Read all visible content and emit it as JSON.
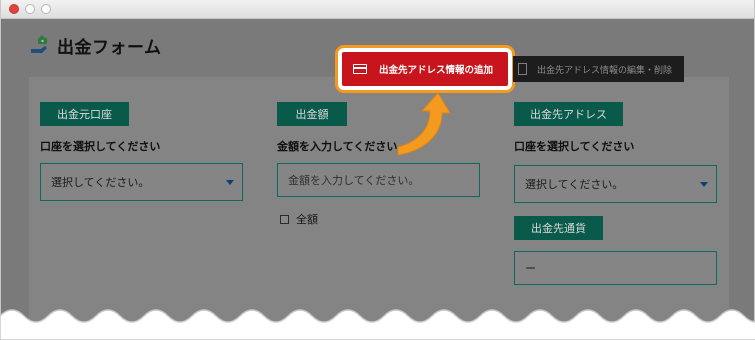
{
  "app": {
    "title": "出金フォーム",
    "title_icon": "money-transfer-icon"
  },
  "toolbar": {
    "add_address_label": "出金先アドレス情報の追加",
    "add_address_icon": "credit-card-icon",
    "edit_address_label": "出金先アドレス情報の編集・削除",
    "edit_address_icon": "document-icon"
  },
  "form": {
    "source_account": {
      "section_label": "出金元口座",
      "field_label": "口座を選択してください",
      "selected": "選択してください。"
    },
    "amount": {
      "section_label": "出金額",
      "field_label": "金額を入力してください",
      "placeholder": "金額を入力してください。",
      "full_amount_label": "全額",
      "full_amount_checked": false
    },
    "destination": {
      "section_label": "出金先アドレス",
      "field_label": "口座を選択してください",
      "selected": "選択してください。"
    },
    "currency": {
      "section_label": "出金先通貨",
      "value": "ー"
    }
  },
  "colors": {
    "highlight_border": "#f39a1f",
    "add_button": "#c8141c",
    "section_label_bg": "#0a5a4b",
    "overlay": "#7a7a7a"
  }
}
